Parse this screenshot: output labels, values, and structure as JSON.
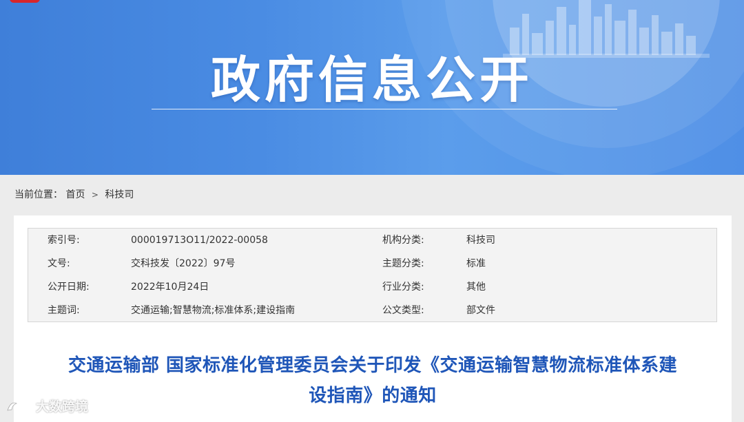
{
  "banner": {
    "title": "政府信息公开"
  },
  "breadcrumb": {
    "label": "当前位置：",
    "items": [
      "首页",
      "科技司"
    ],
    "separator": ">"
  },
  "meta": {
    "rows": [
      {
        "label1": "索引号:",
        "value1": "000019713O11/2022-00058",
        "label2": "机构分类:",
        "value2": "科技司"
      },
      {
        "label1": "文号:",
        "value1": "交科技发〔2022〕97号",
        "label2": "主题分类:",
        "value2": "标准"
      },
      {
        "label1": "公开日期:",
        "value1": "2022年10月24日",
        "label2": "行业分类:",
        "value2": "其他"
      },
      {
        "label1": "主题词:",
        "value1": "交通运输;智慧物流;标准体系;建设指南",
        "label2": "公文类型:",
        "value2": "部文件"
      }
    ]
  },
  "document": {
    "title_line1": "交通运输部 国家标准化管理委员会关于印发《交通运输智慧物流标准体系建",
    "title_line2": "设指南》的通知"
  },
  "watermark": {
    "text": "大数跨境",
    "icon": "ocean-logo-icon"
  },
  "colors": {
    "banner_blue": "#4a8ce3",
    "title_blue": "#1f56b8",
    "logo_red": "#d8262b"
  }
}
